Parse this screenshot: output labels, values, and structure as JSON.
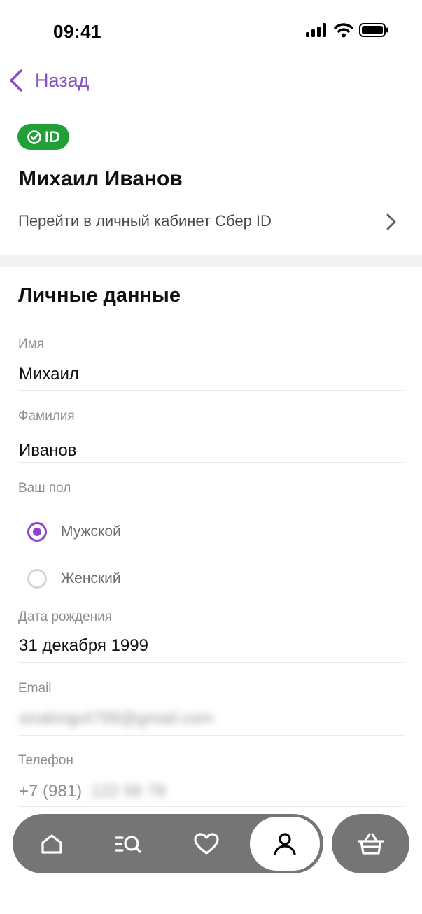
{
  "status_bar": {
    "time": "09:41",
    "icons": [
      "signal-icon",
      "wifi-icon",
      "battery-icon"
    ]
  },
  "nav": {
    "back_label": "Назад",
    "accent_color": "#8a4fc6"
  },
  "sber_id": {
    "badge_text": "ID",
    "badge_color": "#21a038",
    "name": "Михаил Иванов",
    "link_label": "Перейти в личный кабинет Сбер ID"
  },
  "personal": {
    "title": "Личные данные",
    "first_name_label": "Имя",
    "first_name_value": "Михаил",
    "last_name_label": "Фамилия",
    "last_name_value": "Иванов",
    "gender_label": "Ваш пол",
    "gender_options": [
      {
        "label": "Мужской",
        "selected": true
      },
      {
        "label": "Женский",
        "selected": false
      }
    ],
    "birth_label": "Дата рождения",
    "birth_value": "31 декабря 1999",
    "email_label": "Email",
    "email_value": "sirakirqp4799@gmail.com",
    "phone_label": "Телефон",
    "phone_prefix": "+7 (981)",
    "phone_rest": "122 56 78"
  },
  "tab_bar": {
    "items": [
      "home-icon",
      "catalog-search-icon",
      "heart-icon",
      "profile-icon"
    ],
    "active": "profile-icon",
    "cart": "basket-icon",
    "bar_color": "#757575"
  }
}
